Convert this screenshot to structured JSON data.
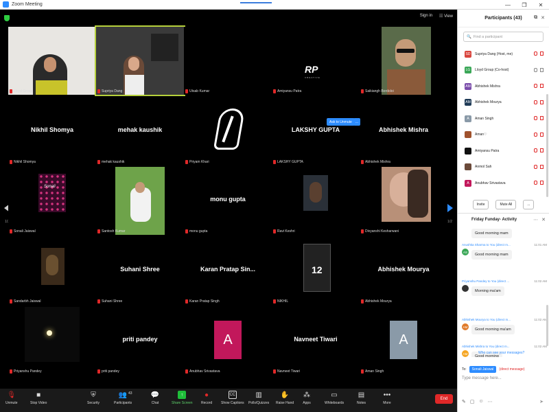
{
  "window": {
    "title": "Zoom Meeting"
  },
  "video": {
    "sign_in": "Sign in",
    "view": "View",
    "page_left": "1/2",
    "page_right": "1/2",
    "ask_unmute": "Ask to Unmute",
    "ask_more": "...",
    "tiles": [
      {
        "name": "Lloyd Group",
        "big": ""
      },
      {
        "name": "Supriya Dang",
        "big": ""
      },
      {
        "name": "Utsab Kumar",
        "big": ""
      },
      {
        "name": "Amiyansu Patra",
        "big": ""
      },
      {
        "name": "Saikiangh Bordoloi",
        "big": ""
      },
      {
        "name": "Nikhil Shomya",
        "big": "Nikhil Shomya"
      },
      {
        "name": "mehak kaushik",
        "big": "mehak kaushik"
      },
      {
        "name": "Priyam Khari",
        "big": ""
      },
      {
        "name": "LAKSHY GUPTA",
        "big": "LAKSHY GUPTA"
      },
      {
        "name": "Abhishek Mishra",
        "big": "Abhishek Mishra"
      },
      {
        "name": "Sonali Jaiswal",
        "big": ""
      },
      {
        "name": "Santosh Kumar",
        "big": ""
      },
      {
        "name": "monu gupta",
        "big": "monu gupta"
      },
      {
        "name": "Ravi Keshri",
        "big": ""
      },
      {
        "name": "Divyanshi Kesharwani",
        "big": ""
      },
      {
        "name": "Sandarbh Jaiswal",
        "big": ""
      },
      {
        "name": "Suhani Shree",
        "big": "Suhani Shree"
      },
      {
        "name": "Karan Pratap Singh",
        "big": "Karan Pratap Sin..."
      },
      {
        "name": "NIKHIL",
        "big": ""
      },
      {
        "name": "Abhishek Mourya",
        "big": "Abhishek Mourya"
      },
      {
        "name": "Priyanshu Pandey",
        "big": ""
      },
      {
        "name": "priti pandey",
        "big": "priti pandey"
      },
      {
        "name": "Anubhav Srivastava",
        "big": ""
      },
      {
        "name": "Navneet Tiwari",
        "big": "Navneet Tiwari"
      },
      {
        "name": "Aman Singh",
        "big": ""
      }
    ],
    "rp_logo": "RP",
    "rp_sub": "CREATIVE",
    "sonali_text": "Sonali",
    "jersey_number": "12",
    "avatar_letter": "A"
  },
  "toolbar": {
    "unmute": "Unmute",
    "stop_video": "Stop Video",
    "security": "Security",
    "participants": "Participants",
    "participants_count": "43",
    "chat": "Chat",
    "share_screen": "Share Screen",
    "record": "Record",
    "show_captions": "Show Captions",
    "polls": "Polls/Quizzes",
    "raise_hand": "Raise Hand",
    "apps": "Apps",
    "whiteboards": "Whiteboards",
    "notes": "Notes",
    "more": "More",
    "end": "End",
    "cc": "CC"
  },
  "participants_panel": {
    "title": "Participants (43)",
    "search_placeholder": "Find a participant",
    "invite": "Invite",
    "mute_all": "Mute All",
    "more": "...",
    "list": [
      {
        "initials": "SD",
        "name": "Supriya Dang (Host, me)",
        "color": "#d9453d"
      },
      {
        "initials": "LG",
        "name": "Lloyd Group (Co-host)",
        "color": "#3aa757"
      },
      {
        "initials": "AM",
        "name": "Abhishek Mishra",
        "color": "#7b4dab"
      },
      {
        "initials": "AM",
        "name": "Abhishek Mourya",
        "color": "#1f3b57"
      },
      {
        "initials": "A",
        "name": "Aman Singh",
        "color": "#8a9aa8"
      },
      {
        "initials": "",
        "name": "Aman♡",
        "color": "#a0522d"
      },
      {
        "initials": "",
        "name": "Amiyansu Patra",
        "color": "#111111"
      },
      {
        "initials": "",
        "name": "Anmol Sah",
        "color": "#6b4a3a"
      },
      {
        "initials": "A",
        "name": "Anubhav Srivastava",
        "color": "#c2185b"
      }
    ]
  },
  "chat_panel": {
    "title": "Friday Funday- Activity",
    "messages": [
      {
        "from": "",
        "time": "",
        "text": "Good morning mam",
        "initials": "",
        "color": "#ffffff"
      },
      {
        "from": "Anushka Sharma to You (direct m...",
        "time": "11:01 AM",
        "text": "Good morning mam",
        "initials": "AS",
        "color": "#3aa757"
      },
      {
        "from": "Priyanshu Pandey to You (direct ...",
        "time": "11:02 AM",
        "text": "Morning ma'am",
        "initials": "",
        "color": "#333333"
      },
      {
        "from": "Abhishek Mourya to You (direct m...",
        "time": "11:02 AM",
        "text": "Good morning ma'am",
        "initials": "AM",
        "color": "#e07b2c"
      },
      {
        "from": "Abhishek Mishra to You (direct m...",
        "time": "11:02 AM",
        "text": "Good morning",
        "initials": "AM",
        "color": "#f5a623"
      }
    ],
    "who_can_see": "Who can see your messages?",
    "to_label": "To:",
    "to_recipient": "Sonali Jaiswal",
    "direct": "(direct message)",
    "placeholder": "Type message here..."
  }
}
